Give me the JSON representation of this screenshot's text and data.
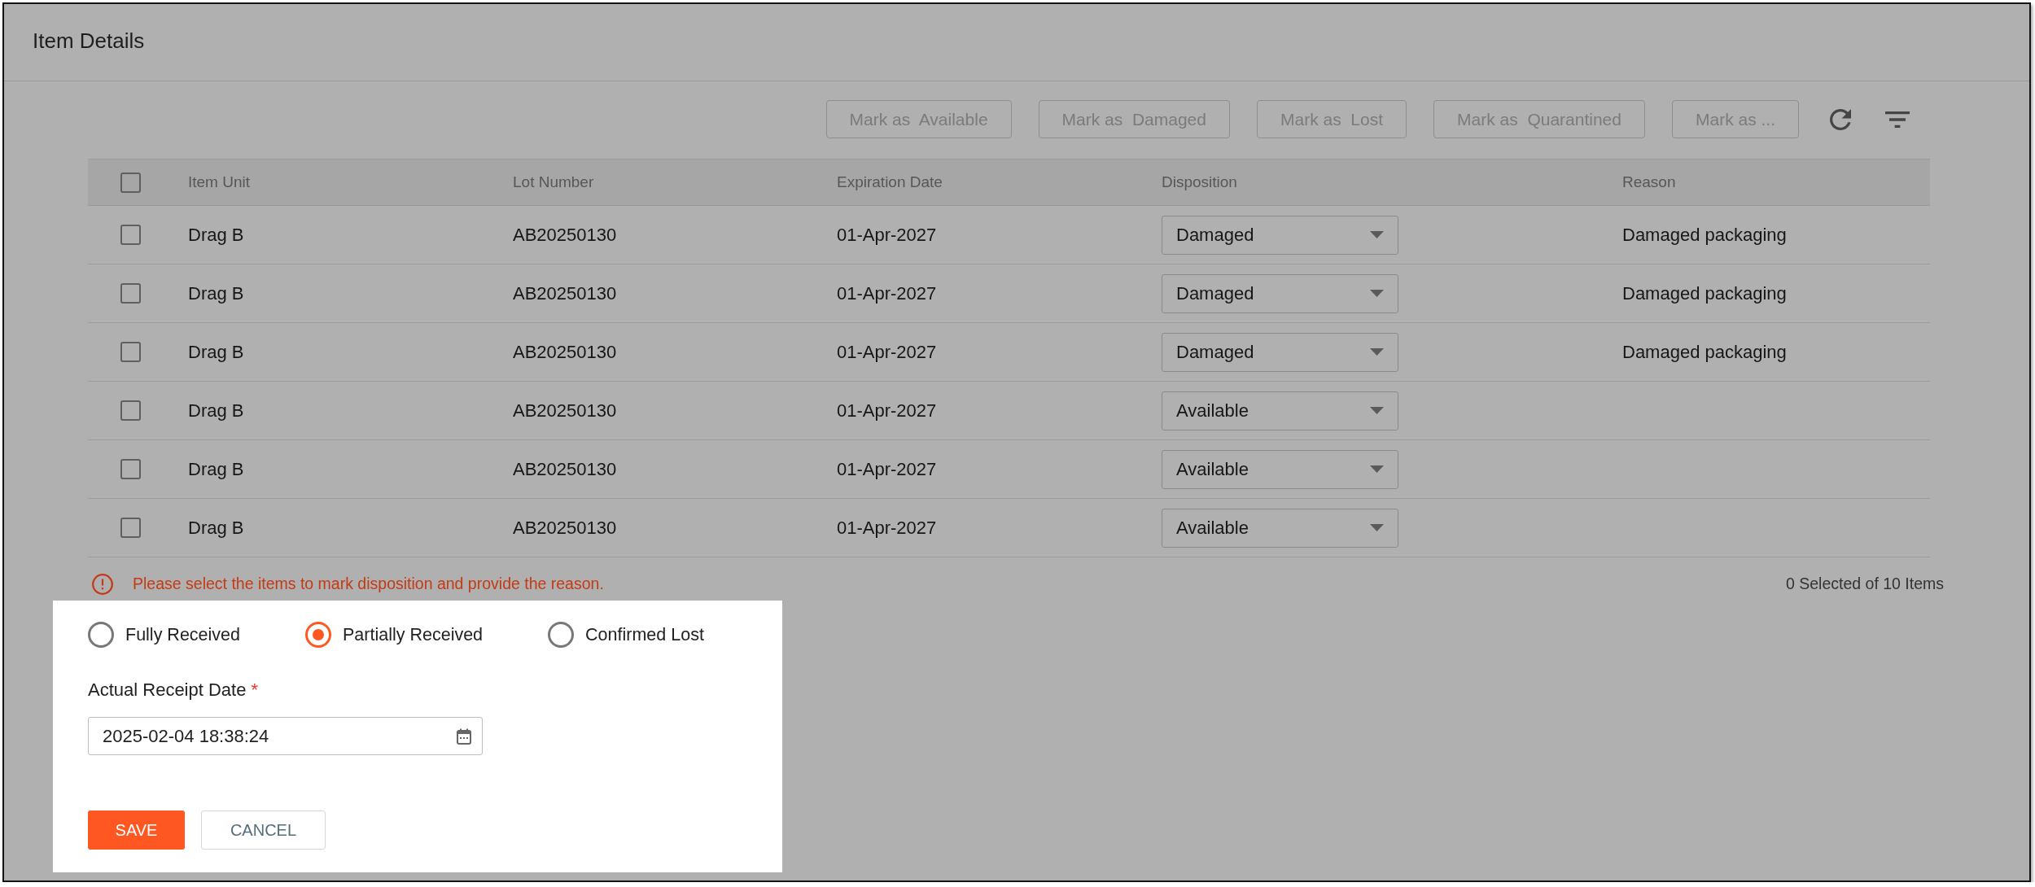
{
  "dialog": {
    "title": "Item Details"
  },
  "toolbar": {
    "buttons": [
      {
        "label": "Mark as  Available",
        "disabled": true
      },
      {
        "label": "Mark as  Damaged",
        "disabled": true
      },
      {
        "label": "Mark as  Lost",
        "disabled": true
      },
      {
        "label": "Mark as  Quarantined",
        "disabled": true
      },
      {
        "label": "Mark as ...",
        "disabled": true
      }
    ]
  },
  "table": {
    "select_all": {
      "checked": false
    },
    "columns": [
      "Item Unit",
      "Lot Number",
      "Expiration Date",
      "Disposition",
      "Reason"
    ],
    "rows": [
      {
        "checked": false,
        "item_unit": "Drag B",
        "lot_number": "AB20250130",
        "expiration_date": "01-Apr-2027",
        "disposition": "Damaged",
        "reason": "Damaged packaging"
      },
      {
        "checked": false,
        "item_unit": "Drag B",
        "lot_number": "AB20250130",
        "expiration_date": "01-Apr-2027",
        "disposition": "Damaged",
        "reason": "Damaged packaging"
      },
      {
        "checked": false,
        "item_unit": "Drag B",
        "lot_number": "AB20250130",
        "expiration_date": "01-Apr-2027",
        "disposition": "Damaged",
        "reason": "Damaged packaging"
      },
      {
        "checked": false,
        "item_unit": "Drag B",
        "lot_number": "AB20250130",
        "expiration_date": "01-Apr-2027",
        "disposition": "Available"
      },
      {
        "checked": false,
        "item_unit": "Drag B",
        "lot_number": "AB20250130",
        "expiration_date": "01-Apr-2027",
        "disposition": "Available"
      },
      {
        "checked": false,
        "item_unit": "Drag B",
        "lot_number": "AB20250130",
        "expiration_date": "01-Apr-2027",
        "disposition": "Available"
      }
    ]
  },
  "footer": {
    "message": {
      "kind": "error",
      "text": "Please select the items to mark disposition and provide the reason."
    },
    "selection_count": "0 Selected of 10 Items"
  },
  "receipt_status": {
    "options": [
      {
        "label": "Fully Received",
        "selected": false
      },
      {
        "label": "Partially Received",
        "selected": true
      },
      {
        "label": "Confirmed Lost",
        "selected": false
      }
    ]
  },
  "receipt_date": {
    "label": "Actual Receipt Date",
    "required_mark": "*",
    "value": "2025-02-04 18:38:24"
  },
  "actions": [
    {
      "label": "SAVE",
      "kind": "primary"
    },
    {
      "label": "CANCEL",
      "kind": "secondary"
    }
  ]
}
